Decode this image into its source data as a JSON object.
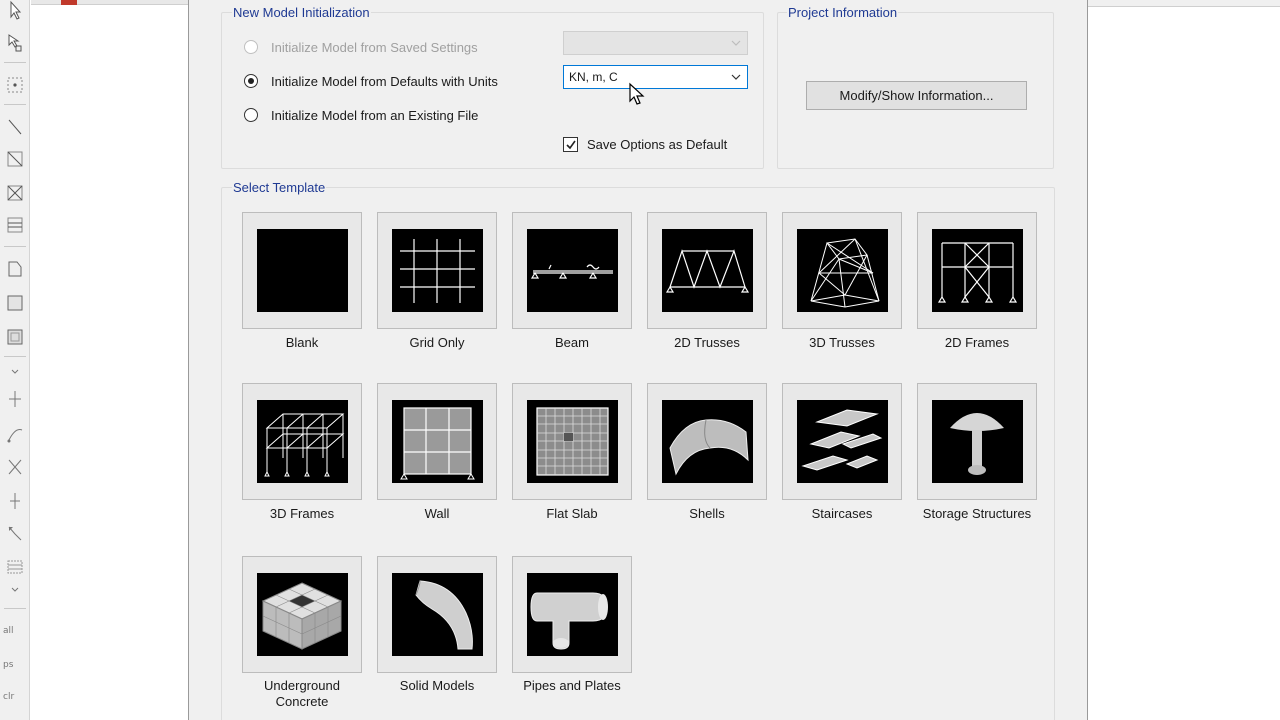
{
  "dialog": {
    "new_model_group": {
      "title": "New Model Initialization",
      "options": [
        {
          "label": "Initialize Model from Saved Settings",
          "checked": false,
          "enabled": false
        },
        {
          "label": "Initialize Model from Defaults with Units",
          "checked": true,
          "enabled": true
        },
        {
          "label": "Initialize Model from an Existing File",
          "checked": false,
          "enabled": true
        }
      ],
      "saved_settings_combo": {
        "value": "",
        "enabled": false
      },
      "units_combo": {
        "value": "KN, m, C",
        "enabled": true
      },
      "save_default": {
        "label": "Save Options as Default",
        "checked": true
      }
    },
    "project_info_group": {
      "title": "Project Information",
      "button_label": "Modify/Show Information..."
    },
    "template_group": {
      "title": "Select Template",
      "templates": [
        {
          "label": "Blank",
          "icon": "blank-template-icon"
        },
        {
          "label": "Grid Only",
          "icon": "grid-only-template-icon"
        },
        {
          "label": "Beam",
          "icon": "beam-template-icon"
        },
        {
          "label": "2D Trusses",
          "icon": "2d-trusses-template-icon"
        },
        {
          "label": "3D Trusses",
          "icon": "3d-trusses-template-icon"
        },
        {
          "label": "2D Frames",
          "icon": "2d-frames-template-icon"
        },
        {
          "label": "3D Frames",
          "icon": "3d-frames-template-icon"
        },
        {
          "label": "Wall",
          "icon": "wall-template-icon"
        },
        {
          "label": "Flat Slab",
          "icon": "flat-slab-template-icon"
        },
        {
          "label": "Shells",
          "icon": "shells-template-icon"
        },
        {
          "label": "Staircases",
          "icon": "staircases-template-icon"
        },
        {
          "label": "Storage Structures",
          "icon": "storage-structures-template-icon"
        },
        {
          "label": "Underground\nConcrete",
          "icon": "underground-concrete-template-icon"
        },
        {
          "label": "Solid Models",
          "icon": "solid-models-template-icon"
        },
        {
          "label": "Pipes and Plates",
          "icon": "pipes-and-plates-template-icon"
        }
      ]
    }
  },
  "toolbar": {
    "text_labels": [
      "all",
      "ps",
      "clr"
    ]
  },
  "colors": {
    "group_title": "#1f3a93",
    "dialog_bg": "#f0f0f0",
    "focus_border": "#0078d7"
  }
}
